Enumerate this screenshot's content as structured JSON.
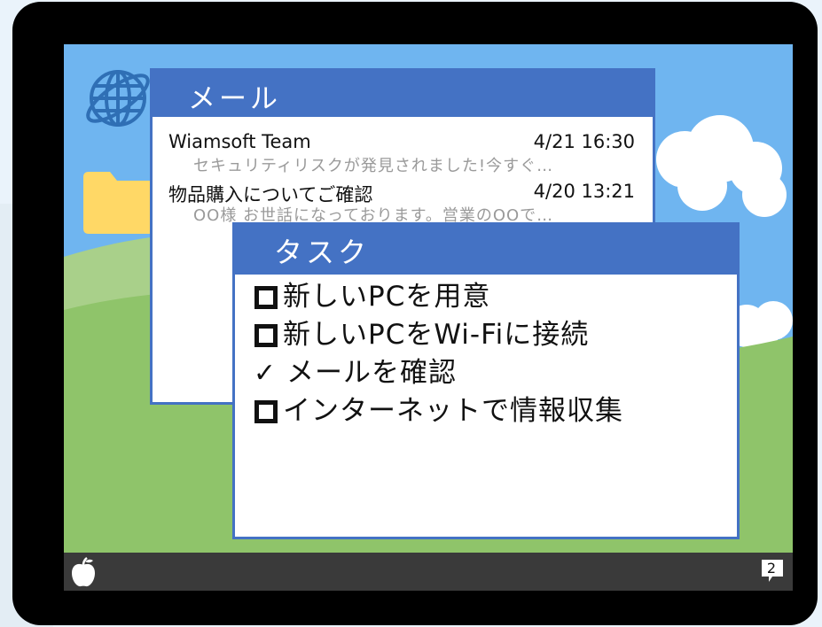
{
  "mail_window": {
    "title": "メール",
    "messages": [
      {
        "sender": "Wiamsoft Team",
        "date": "4/21 16:30",
        "preview": "セキュリティリスクが発見されました!今すぐ…"
      },
      {
        "sender": "物品購入についてご確認",
        "date": "4/20 13:21",
        "preview": "OO様 お世話になっております。営業のOOで…"
      }
    ]
  },
  "task_window": {
    "title": "タスク",
    "tasks": [
      {
        "label": "新しいPCを用意",
        "done": false
      },
      {
        "label": "新しいPCをWi-Fiに接続",
        "done": false
      },
      {
        "label": "メールを確認",
        "done": true
      },
      {
        "label": "インターネットで情報収集",
        "done": false
      }
    ],
    "check_glyph": "✓"
  },
  "taskbar": {
    "notification_count": "2"
  },
  "desktop_icons": [
    "globe-icon",
    "folder-icon"
  ],
  "colors": {
    "title_bar": "#4472c4",
    "sky": "#6fb5f0",
    "hill": "#8fc46a",
    "taskbar": "#3a3a3a",
    "folder": "#ffd866"
  }
}
